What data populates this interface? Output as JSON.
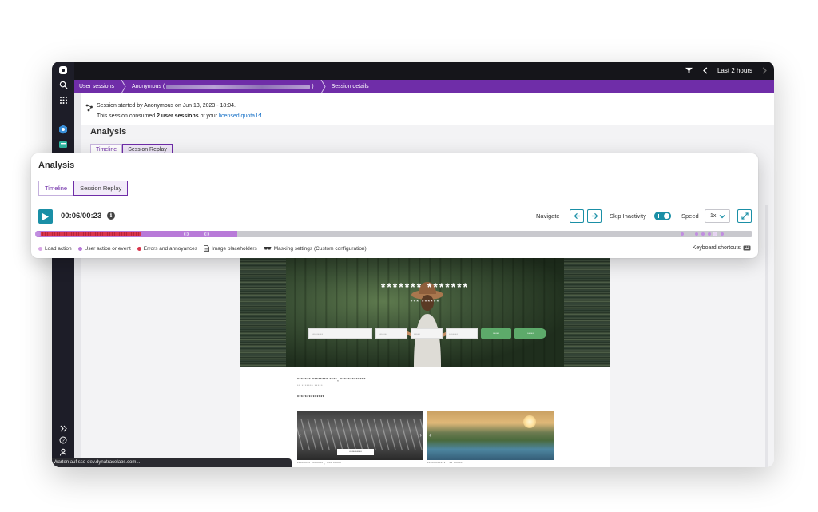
{
  "topbar": {
    "timeframe_label": "Last 2 hours"
  },
  "breadcrumb": {
    "items": [
      "User sessions",
      "Anonymous (",
      ")",
      "Session details"
    ]
  },
  "session": {
    "line1": "Session started by Anonymous on Jun 13, 2023 - 18:04.",
    "line2_prefix": "This session consumed ",
    "line2_bold": "2 user sessions",
    "line2_mid": " of your ",
    "line2_link": "licensed quota",
    "line2_suffix": "."
  },
  "analysis": {
    "title": "Analysis",
    "tabs": [
      {
        "label": "Timeline",
        "active": false
      },
      {
        "label": "Session Replay",
        "active": true
      }
    ]
  },
  "player": {
    "time": "00:06/00:23",
    "navigate_label": "Navigate",
    "skip_label": "Skip Inactivity",
    "skip_enabled": true,
    "speed_label": "Speed",
    "speed_value": "1x",
    "progress_fraction": 0.28,
    "errors_end_fraction": 0.145
  },
  "legend": {
    "items": [
      {
        "label": "Load action",
        "color": "#d9a7e6"
      },
      {
        "label": "User action or event",
        "color": "#b87ad8"
      },
      {
        "label": "Errors and annoyances",
        "color": "#d9344a"
      },
      {
        "label": "Image placeholders",
        "icon": "image-placeholder-icon"
      },
      {
        "label": "Masking settings (Custom configuration)",
        "icon": "mask-icon"
      }
    ],
    "keyboard_shortcuts": "Keyboard shortcuts"
  },
  "replay": {
    "hero_title": "******* *******",
    "hero_subtitle": "*** ******",
    "field1": "*********",
    "field2": "*******",
    "field3": "*****",
    "field4": "*******",
    "button1": "*****",
    "button2": "*****",
    "heading1": "******* ******** ****, *************",
    "heading1_sub": "** ******* *****",
    "heading2": "**************",
    "thumb1_overlay": "**********",
    "thumb1_caption": "******** ******* ,  ***  *****",
    "thumb2_caption": "*********** ,  **  ******"
  },
  "statusbar": {
    "text": "Warten auf sso-dev.dynatracelabs.com..."
  },
  "colors": {
    "accent_purple": "#6f2da8",
    "teal": "#1a8fa6",
    "error_red": "#d9344a"
  }
}
